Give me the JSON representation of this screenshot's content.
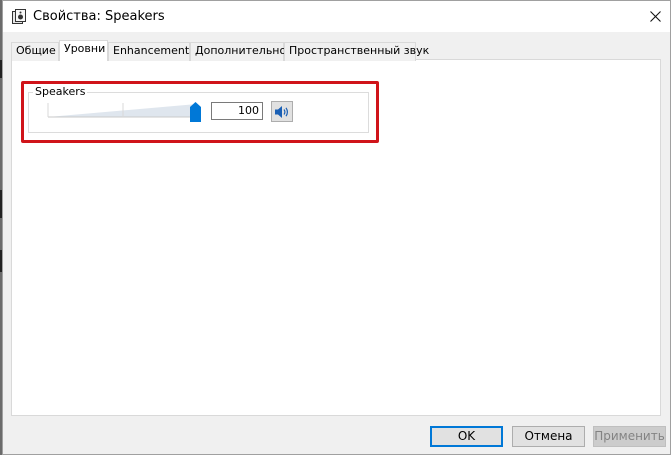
{
  "window": {
    "title": "Свойства: Speakers"
  },
  "tabs": [
    {
      "label": "Общие",
      "active": false
    },
    {
      "label": "Уровни",
      "active": true
    },
    {
      "label": "Enhancements",
      "active": false
    },
    {
      "label": "Дополнительно",
      "active": false
    },
    {
      "label": "Пространственный звук",
      "active": false
    }
  ],
  "levels": {
    "group_label": "Speakers",
    "volume_fraction": 1.0,
    "volume_value": "100"
  },
  "buttons": {
    "ok": "OK",
    "cancel": "Отмена",
    "apply": "Применить"
  },
  "colors": {
    "accent": "#0078d7",
    "highlight": "#d0141a",
    "thumb": "#0078d7"
  },
  "icons": {
    "app": "speaker-app-icon",
    "close": "close-icon",
    "mute": "speaker-volume-icon"
  }
}
